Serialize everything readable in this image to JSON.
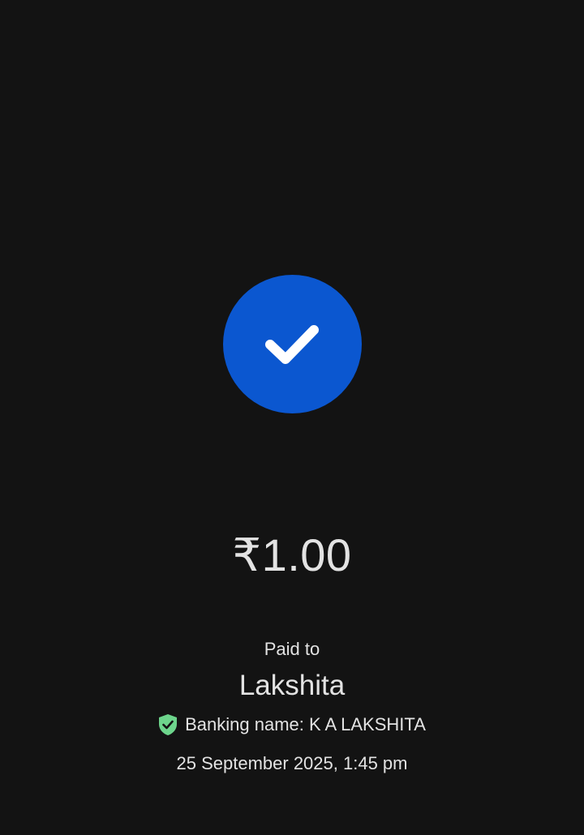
{
  "status": {
    "icon": "check-icon",
    "circle_color": "#0b57d0"
  },
  "payment": {
    "amount": "₹1.00",
    "paid_to_label": "Paid to",
    "payee_name": "Lakshita",
    "banking_name": "Banking name: K A LAKSHITA",
    "verified_icon": "verified-shield-icon",
    "verified_color": "#6dd58c",
    "timestamp": "25 September 2025, 1:45 pm"
  }
}
